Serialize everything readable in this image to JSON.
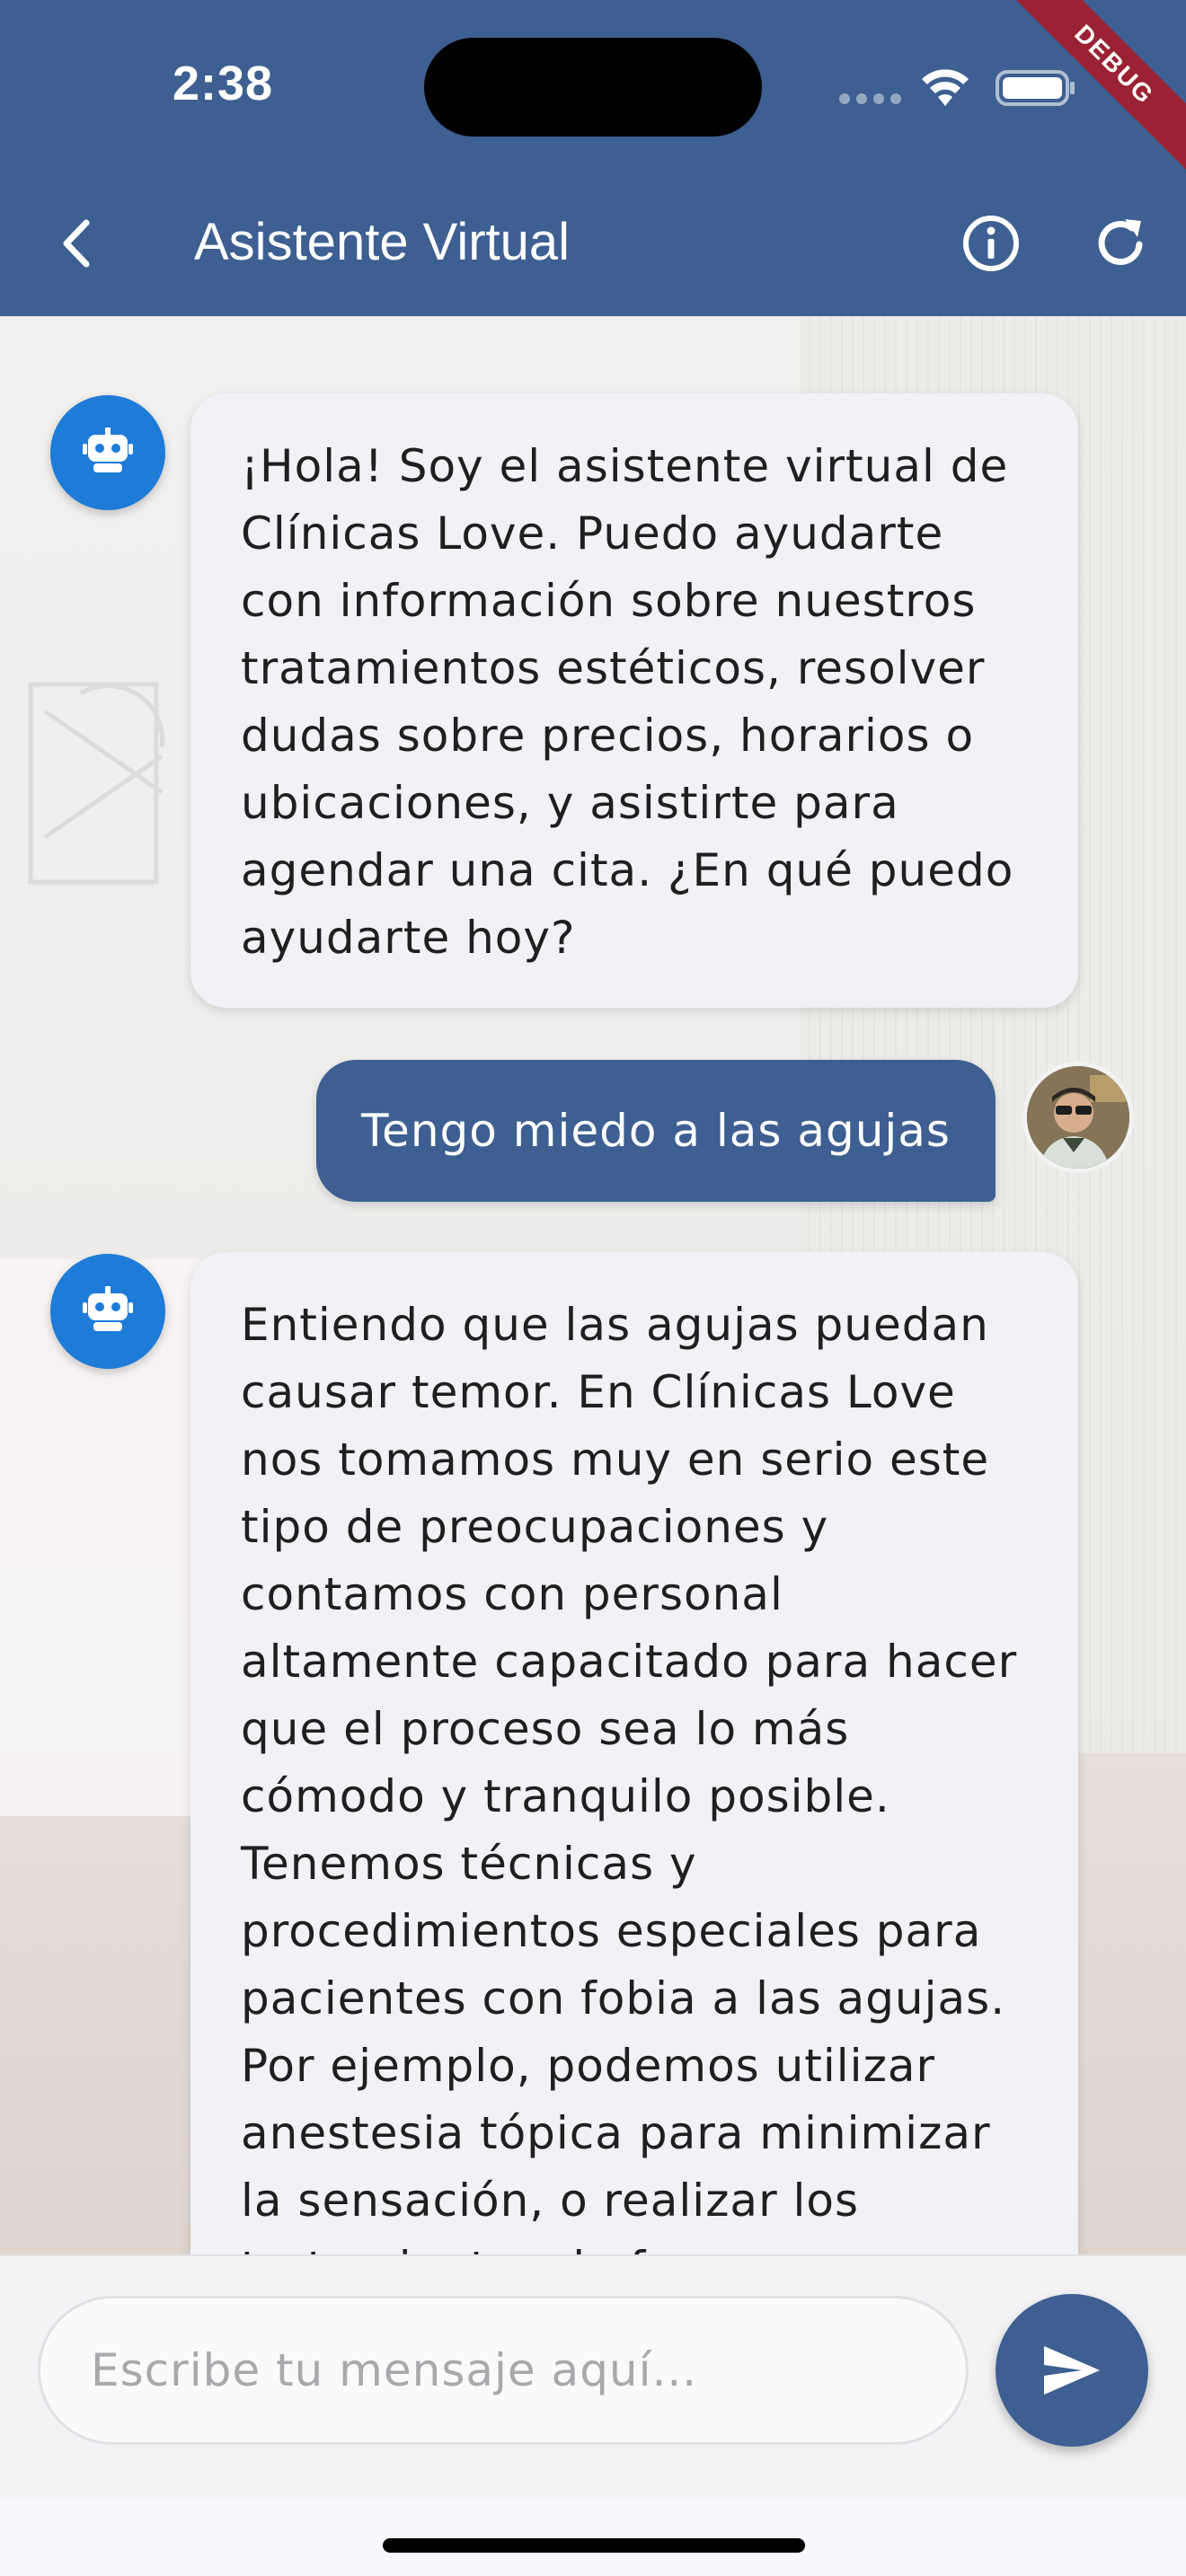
{
  "status_bar": {
    "time": "2:38"
  },
  "debug_banner": "DEBUG",
  "app_bar": {
    "title": "Asistente Virtual",
    "back_icon": "chevron-left-icon",
    "info_icon": "info-icon",
    "refresh_icon": "refresh-icon"
  },
  "messages": [
    {
      "sender": "bot",
      "avatar_icon": "robot-icon",
      "text": "¡Hola! Soy el asistente virtual de Clínicas Love. Puedo ayudarte con información sobre nuestros tratamientos estéticos, resolver dudas sobre precios, horarios o ubicaciones, y asistirte para agendar una cita. ¿En qué puedo ayudarte hoy?"
    },
    {
      "sender": "user",
      "avatar_icon": "user-avatar",
      "text": "Tengo miedo a las agujas"
    },
    {
      "sender": "bot",
      "avatar_icon": "robot-icon",
      "text": "Entiendo que las agujas puedan causar temor. En Clínicas Love nos tomamos muy en serio este tipo de preocupaciones y contamos con personal altamente capacitado para hacer que el proceso sea lo más cómodo y tranquilo posible. Tenemos técnicas y procedimientos especiales para pacientes con fobia a las agujas. Por ejemplo, podemos utilizar anestesia tópica para minimizar la sensación, o realizar los tratamientos de forma"
    }
  ],
  "composer": {
    "placeholder": "Escribe tu mensaje aquí...",
    "value": "",
    "send_icon": "send-icon"
  },
  "colors": {
    "primary": "#3d5f91",
    "bot_avatar": "#1e7bd8",
    "bot_bubble": "#f1f2f6",
    "debug_ribbon": "#9a2233"
  }
}
